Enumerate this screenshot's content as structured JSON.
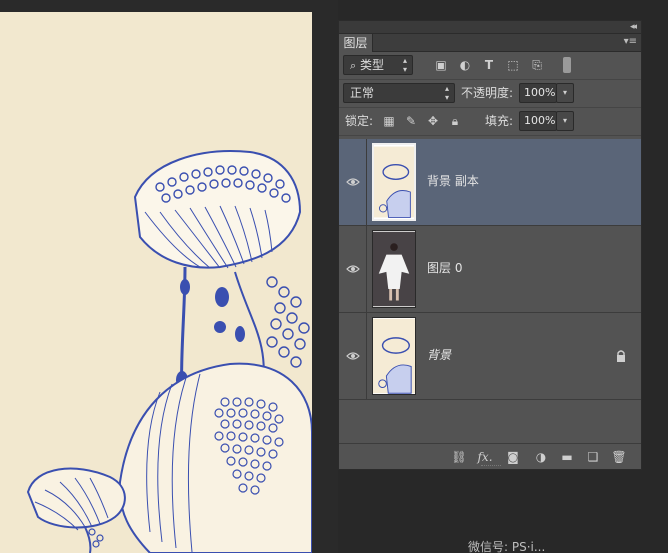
{
  "panel": {
    "tab_label": "图层",
    "filter": {
      "label": "类型",
      "icon": "search-icon"
    },
    "blend_mode": "正常",
    "opacity_label": "不透明度:",
    "opacity_value": "100%",
    "lock_label": "锁定:",
    "fill_label": "填充:",
    "fill_value": "100%"
  },
  "layers": [
    {
      "name": "背景 副本",
      "visible": true,
      "selected": true,
      "locked": false,
      "italic": false
    },
    {
      "name": "图层 0",
      "visible": true,
      "selected": false,
      "locked": false,
      "italic": false
    },
    {
      "name": "背景",
      "visible": true,
      "selected": false,
      "locked": true,
      "italic": true
    }
  ],
  "bottom_icons": [
    "link-icon",
    "fx-icon",
    "mask-icon",
    "adjustment-icon",
    "folder-icon",
    "new-layer-icon",
    "trash-icon"
  ],
  "bottom_fx_label": "fx.",
  "watermark": "微信号: PS·i...",
  "colors": {
    "panel_bg": "#535353",
    "selected_row": "#5a6578",
    "ink_blue": "#3a4fb0",
    "paper": "#f5ebd5"
  }
}
